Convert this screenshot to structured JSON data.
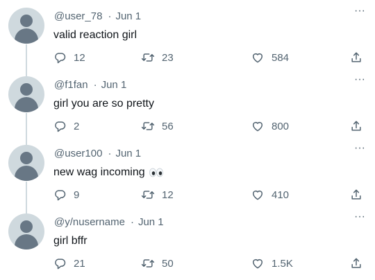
{
  "tweets": [
    {
      "user": "@user_78",
      "date": "Jun 1",
      "text": "valid reaction girl",
      "emoji": "",
      "replies": "12",
      "retweets": "23",
      "likes": "584"
    },
    {
      "user": "@f1fan",
      "date": "Jun 1",
      "text": "girl you are so pretty",
      "emoji": "",
      "replies": "2",
      "retweets": "56",
      "likes": "800"
    },
    {
      "user": "@user100",
      "date": "Jun 1",
      "text": "new wag incoming",
      "emoji": "eyes-emoji",
      "replies": "9",
      "retweets": "12",
      "likes": "410"
    },
    {
      "user": "@y/nusername",
      "date": "Jun 1",
      "text": "girl bffr",
      "emoji": "",
      "replies": "21",
      "retweets": "50",
      "likes": "1.5K"
    }
  ],
  "separator": "·",
  "more_glyph": "···",
  "colors": {
    "muted": "#536471",
    "text": "#0f1419",
    "thread_line": "#cfd9de",
    "avatar_bg": "#cfd9de",
    "avatar_fg": "#687785"
  },
  "icons": {
    "reply": "reply-icon",
    "retweet": "retweet-icon",
    "like": "heart-icon",
    "share": "share-icon",
    "more": "more-icon"
  }
}
